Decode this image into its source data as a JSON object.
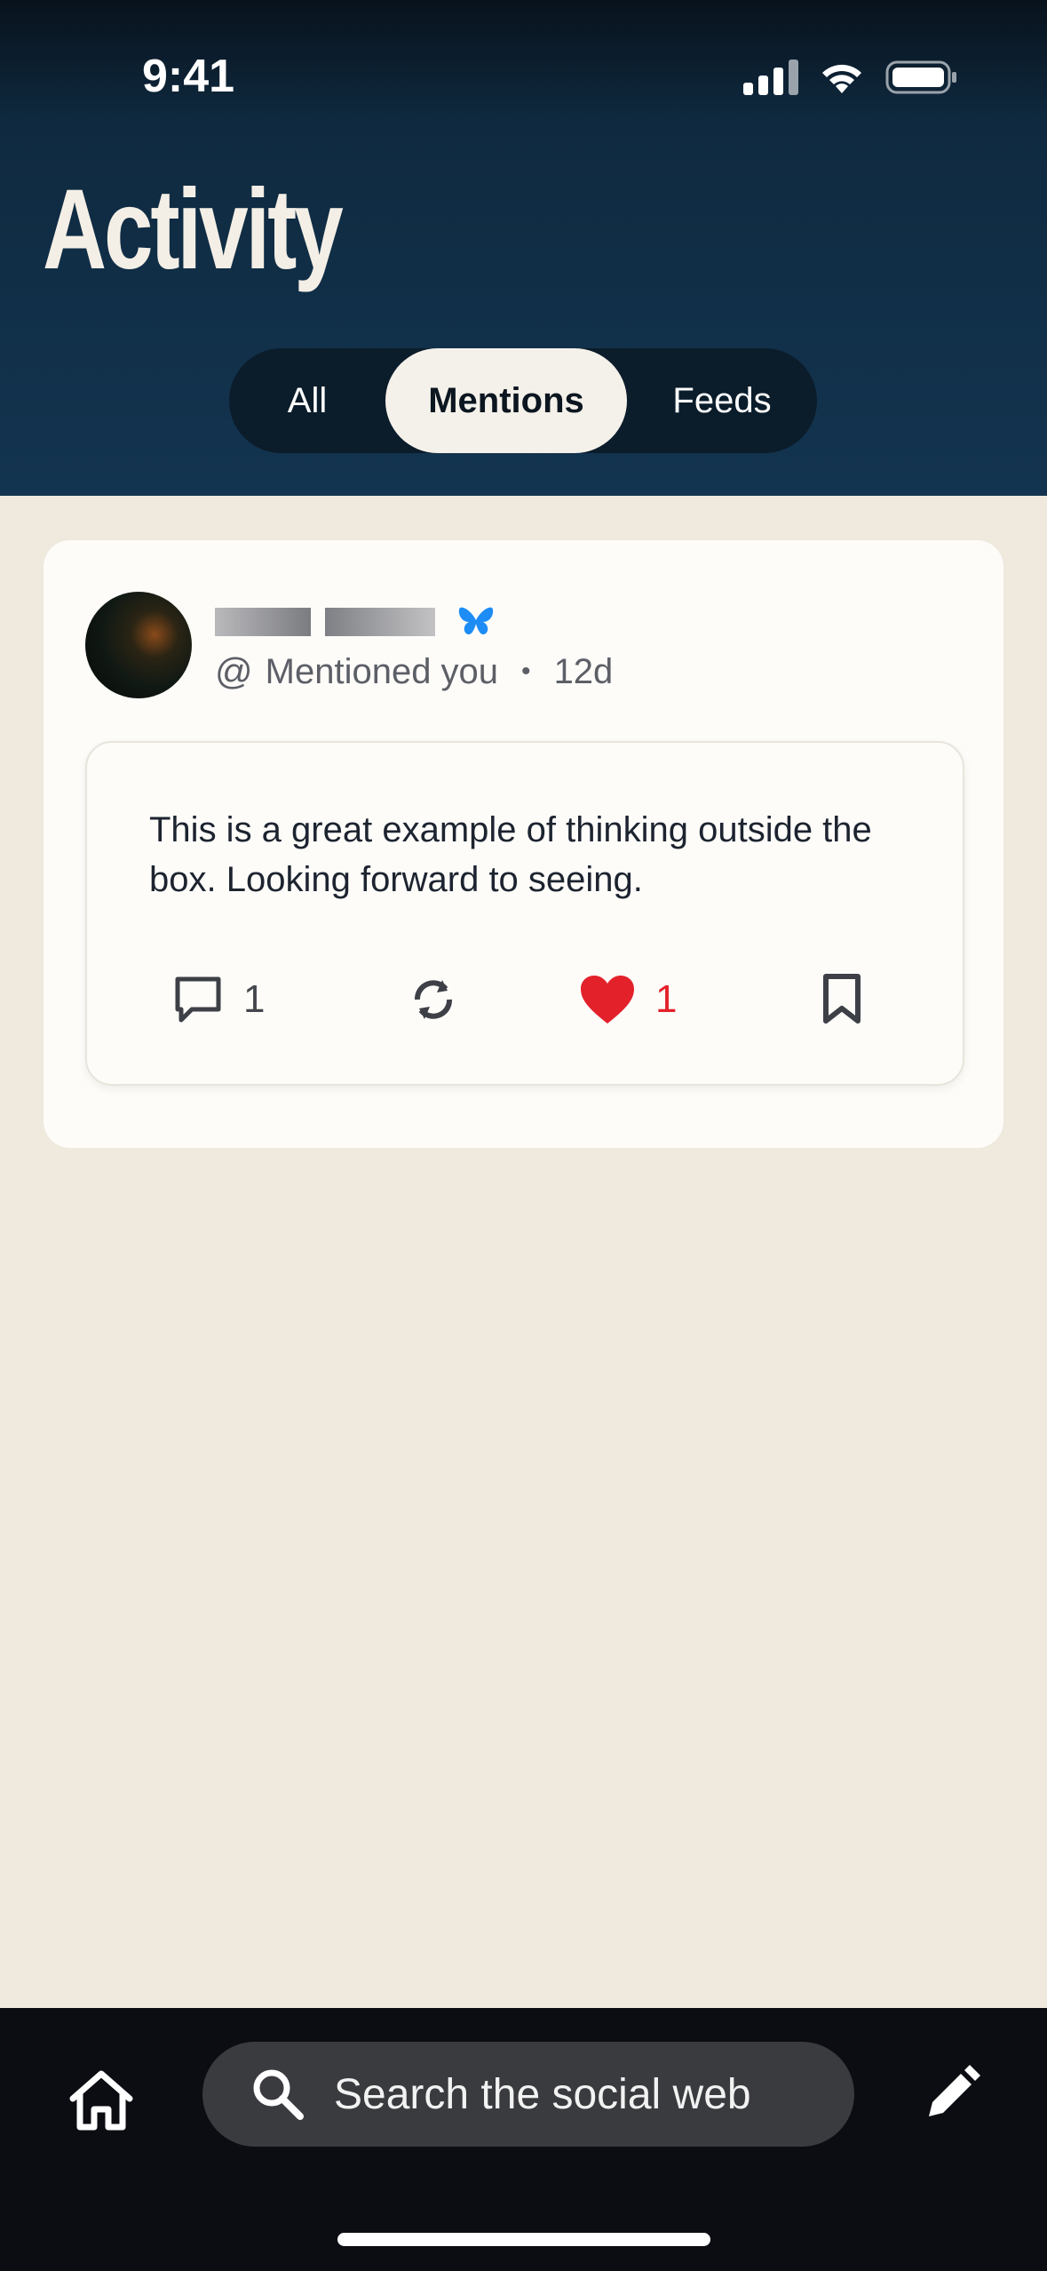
{
  "status": {
    "time": "9:41"
  },
  "header": {
    "title": "Activity",
    "tabs": [
      {
        "label": "All",
        "selected": false
      },
      {
        "label": "Mentions",
        "selected": true
      },
      {
        "label": "Feeds",
        "selected": false
      }
    ]
  },
  "notification": {
    "type_label": "Mentioned you",
    "separator": "•",
    "age": "12d",
    "post": {
      "text": "This is a great example of thinking outside the box. Looking forward to seeing.",
      "reply_count": "1",
      "like_count": "1",
      "liked": true
    }
  },
  "bottom_bar": {
    "search_placeholder": "Search the social web"
  },
  "colors": {
    "header": "#133450",
    "background": "#efe9de",
    "like": "#e3212b",
    "verified_butterfly": "#1d8cf5"
  }
}
